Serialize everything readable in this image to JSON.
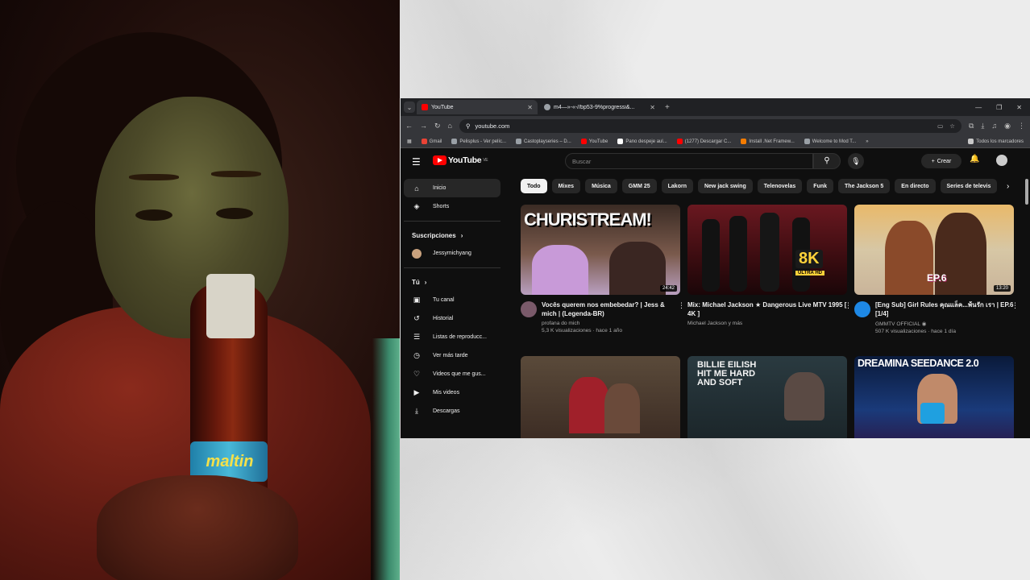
{
  "browser": {
    "tabs": [
      {
        "title": "YouTube",
        "favicon_color": "#ff0000",
        "active": true
      },
      {
        "title": "m4—»-«-//bp53-9%progressi&...",
        "favicon_color": "#9aa0a6",
        "active": false
      }
    ],
    "address": "youtube.com",
    "bookmarks": [
      {
        "label": "Gmail",
        "color": "#ea4335"
      },
      {
        "label": "Pelisplus - Ver pelíc...",
        "color": "#9aa0a6"
      },
      {
        "label": "Castoplayseries – D...",
        "color": "#9aa0a6"
      },
      {
        "label": "YouTube",
        "color": "#ff0000"
      },
      {
        "label": "Pano despeje aul...",
        "color": "#ffffff"
      },
      {
        "label": "(1277) Descargar C...",
        "color": "#ff0000"
      },
      {
        "label": "Install .Net Framew...",
        "color": "#f57c00"
      },
      {
        "label": "Welcome to Mod T...",
        "color": "#9aa0a6"
      }
    ],
    "bookmarks_more": "»",
    "all_bookmarks": "Todos los marcadores"
  },
  "youtube": {
    "logo_text": "YouTube",
    "logo_region": "VE",
    "search_placeholder": "Buscar",
    "create_label": "Crear",
    "sidebar": {
      "main": [
        {
          "label": "Inicio",
          "icon": "home-icon",
          "glyph": "⌂",
          "active": true
        },
        {
          "label": "Shorts",
          "icon": "shorts-icon",
          "glyph": "◈",
          "active": false
        }
      ],
      "subs_header": "Suscripciones",
      "subs": [
        {
          "label": "Jessymichyang"
        }
      ],
      "you_header": "Tú",
      "you": [
        {
          "label": "Tu canal",
          "icon": "channel-icon",
          "glyph": "▣"
        },
        {
          "label": "Historial",
          "icon": "history-icon",
          "glyph": "↺"
        },
        {
          "label": "Listas de reproducc...",
          "icon": "playlist-icon",
          "glyph": "☰"
        },
        {
          "label": "Ver más tarde",
          "icon": "clock-icon",
          "glyph": "◷"
        },
        {
          "label": "Videos que me gus...",
          "icon": "like-icon",
          "glyph": "👍"
        },
        {
          "label": "Mis videos",
          "icon": "my-videos-icon",
          "glyph": "▶"
        },
        {
          "label": "Descargas",
          "icon": "download-icon",
          "glyph": "⤓"
        }
      ]
    },
    "chips": [
      "Todo",
      "Mixes",
      "Música",
      "GMM 25",
      "Lakorn",
      "New jack swing",
      "Telenovelas",
      "Funk",
      "The Jackson 5",
      "En directo",
      "Series de televis"
    ],
    "videos": [
      {
        "title": "Vocês querem nos embebedar? | Jess & mich | (Legenda-BR)",
        "channel": "profana do mich",
        "stats": "5,3 K visualizaciones · hace 1 año",
        "duration": "24:42",
        "thumb_text": "CHURISTREAM!",
        "avatar_color": "#7a5a6a"
      },
      {
        "title": "Mix: Michael Jackson ★ Dangerous Live MTV 1995 [ 4K ]",
        "channel": "Michael Jackson y más",
        "stats": "",
        "duration": "",
        "thumb_text": "8K",
        "thumb_sub": "ULTRA HD",
        "avatar_color": ""
      },
      {
        "title": "[Eng Sub] Girl Rules คุณแล็ค...พ้นรัก เรา | EP.6 [1/4]",
        "channel": "GMMTV OFFICIAL ◉",
        "stats": "507 K visualizaciones · hace 1 día",
        "duration": "13:20",
        "thumb_text": "EP.6",
        "avatar_color": "#1e88e5"
      },
      {
        "title": "",
        "channel": "",
        "stats": "",
        "duration": "",
        "thumb_text": "",
        "avatar_color": ""
      },
      {
        "title": "",
        "channel": "",
        "stats": "",
        "duration": "",
        "thumb_text": "BILLIE EILISH HIT ME HARD AND SOFT",
        "avatar_color": ""
      },
      {
        "title": "",
        "channel": "",
        "stats": "",
        "duration": "",
        "thumb_text": "DREAMINA SEEDANCE 2.0",
        "avatar_color": ""
      }
    ]
  },
  "webcam": {
    "bottle_label": "maltin"
  }
}
